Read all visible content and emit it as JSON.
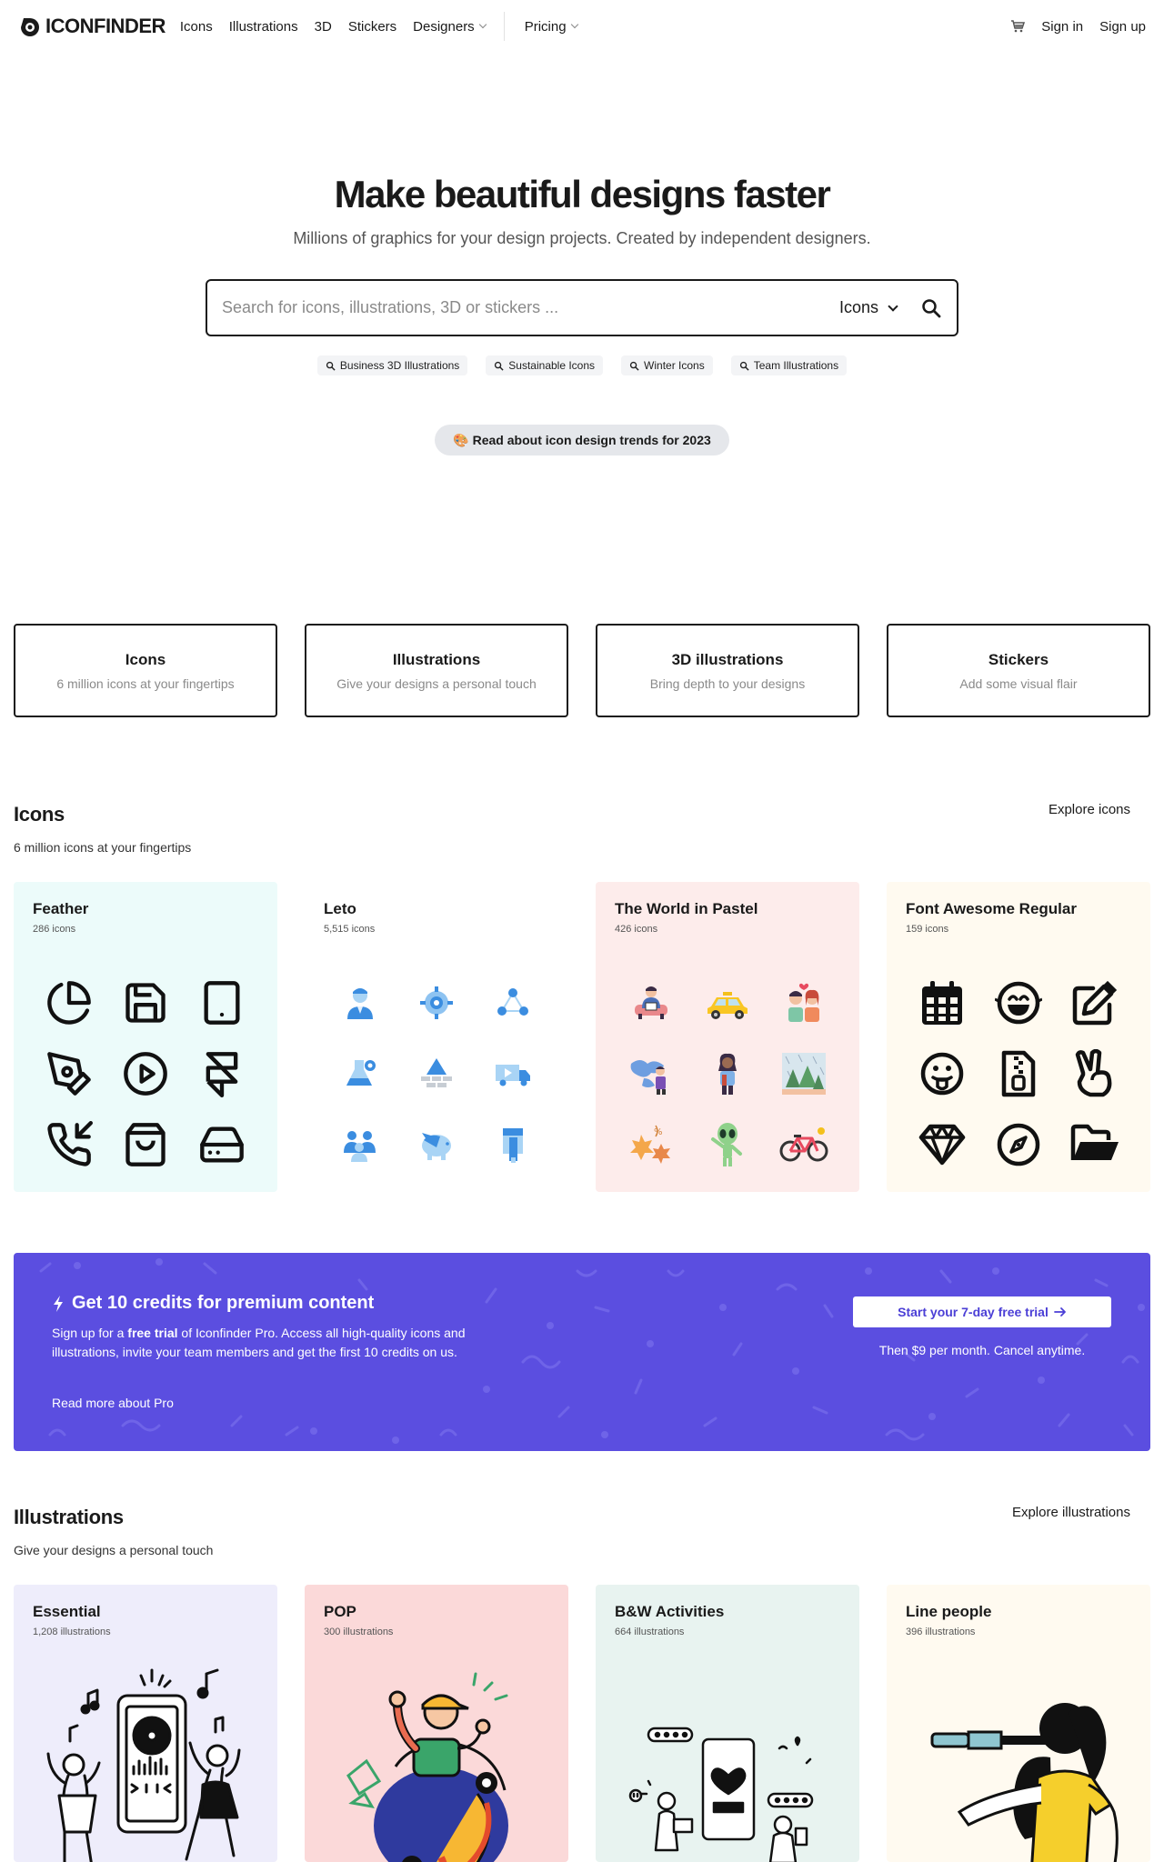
{
  "header": {
    "logo_text": "ICONFINDER",
    "nav": [
      {
        "label": "Icons"
      },
      {
        "label": "Illustrations"
      },
      {
        "label": "3D"
      },
      {
        "label": "Stickers"
      }
    ],
    "designers_label": "Designers",
    "pricing_label": "Pricing",
    "sign_in": "Sign in",
    "sign_up": "Sign up"
  },
  "hero": {
    "title_before": "Make ",
    "title_highlight": "beautiful designs",
    "title_after": " faster",
    "subtitle": "Millions of graphics for your design projects. Created by independent designers.",
    "search_placeholder": "Search for icons, illustrations, 3D or stickers ...",
    "search_type": "Icons",
    "chips": [
      "Business 3D Illustrations",
      "Sustainable Icons",
      "Winter Icons",
      "Team Illustrations"
    ],
    "trend_emoji": "🎨",
    "trend_text": "Read about icon design trends for 2023"
  },
  "categories": [
    {
      "title": "Icons",
      "desc": "6 million icons at your fingertips"
    },
    {
      "title": "Illustrations",
      "desc": "Give your designs a personal touch"
    },
    {
      "title": "3D illustrations",
      "desc": "Bring depth to your designs"
    },
    {
      "title": "Stickers",
      "desc": "Add some visual flair"
    }
  ],
  "icons_section": {
    "title": "Icons",
    "subtitle": "6 million icons at your fingertips",
    "link": "Explore icons",
    "sets": [
      {
        "name": "Feather",
        "count": "286 icons",
        "bg": "#ecfbfa"
      },
      {
        "name": "Leto",
        "count": "5,515 icons",
        "bg": "#ffffff"
      },
      {
        "name": "The World in Pastel",
        "count": "426 icons",
        "bg": "#fdeceb"
      },
      {
        "name": "Font Awesome Regular",
        "count": "159 icons",
        "bg": "#fffaf0"
      }
    ]
  },
  "promo": {
    "title": "Get 10 credits for premium content",
    "text_1": "Sign up for a ",
    "text_bold": "free trial",
    "text_2": " of Iconfinder Pro. Access all high-quality icons and illustrations, invite your team members and get the first 10 credits on us.",
    "link": "Read more about Pro",
    "button": "Start your 7-day free trial",
    "note": "Then $9 per month. Cancel anytime.",
    "bg": "#5b4ee0"
  },
  "illustrations_section": {
    "title": "Illustrations",
    "subtitle": "Give your designs a personal touch",
    "link": "Explore illustrations",
    "sets": [
      {
        "name": "Essential",
        "count": "1,208 illustrations",
        "bg": "#eeedfb"
      },
      {
        "name": "POP",
        "count": "300 illustrations",
        "bg": "#fbd9d9"
      },
      {
        "name": "B&W Activities",
        "count": "664 illustrations",
        "bg": "#e8f3f0"
      },
      {
        "name": "Line people",
        "count": "396 illustrations",
        "bg": "#fffaf0"
      }
    ]
  }
}
